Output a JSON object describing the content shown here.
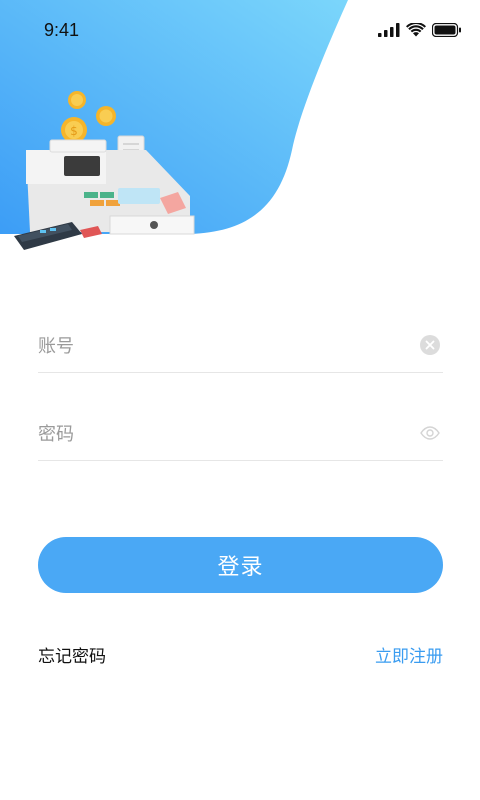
{
  "status_bar": {
    "time": "9:41",
    "icons": [
      "cellular-signal-icon",
      "wifi-icon",
      "battery-icon"
    ]
  },
  "header": {
    "illustration": "cash-register-illustration",
    "colors": {
      "gradient_start": "#3fa0f7",
      "gradient_end": "#76d3fb"
    }
  },
  "form": {
    "account": {
      "placeholder": "账号",
      "value": "",
      "action_icon": "clear-icon"
    },
    "password": {
      "placeholder": "密码",
      "value": "",
      "action_icon": "eye-icon"
    }
  },
  "actions": {
    "login_label": "登录",
    "forgot_password_label": "忘记密码",
    "register_label": "立即注册"
  },
  "colors": {
    "accent": "#4aa8f5",
    "link": "#3a9cf0"
  }
}
